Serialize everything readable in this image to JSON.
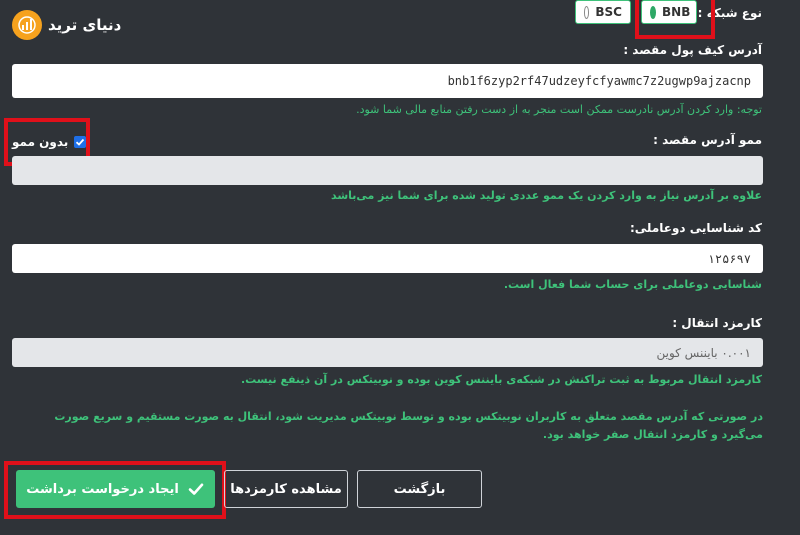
{
  "logo": {
    "text": "دنیای ترید"
  },
  "network": {
    "label": "نوع شبکه :",
    "options": [
      {
        "label": "BNB",
        "selected": true
      },
      {
        "label": "BSC",
        "selected": false
      }
    ]
  },
  "wallet_address": {
    "label": "آدرس کیف پول مقصد :",
    "value": "bnb1f6zyp2rf47udzeyfcfyawmc7z2ugwp9ajzacnp",
    "warning": "توجه: وارد کردن آدرس نادرست ممکن است منجر به از دست رفتن منابع مالی شما شود."
  },
  "memo": {
    "label": "ممو آدرس مقصد :",
    "no_memo_label": "بدون ممو",
    "no_memo_checked": true,
    "value": "",
    "hint": "علاوه بر آدرس نیاز به وارد کردن یک ممو عددی تولید شده برای شما نیز می‌باشد"
  },
  "two_factor": {
    "label": "کد شناسایی دوعاملی:",
    "value": "۱۲۵۶۹۷",
    "hint": "شناسایی دوعاملی برای حساب شما فعال است."
  },
  "fee": {
    "label": "کارمزد انتقال :",
    "value": "۰.۰۰۱ بایننس کوین",
    "hint": "کارمزد انتقال مربوط به ثبت تراکنش در شبکه‌ی بایننس کوین بوده و نوبیتکس در آن ذینفع نیست."
  },
  "internal_note": "در صورتی که آدرس مقصد متعلق به کاربران نوبیتکس بوده و توسط نوبیتکس مدیریت شود، انتقال به صورت مستقیم و سریع صورت می‌گیرد و کارمزد انتقال صفر خواهد بود.",
  "buttons": {
    "create": "ایجاد درخواست برداشت",
    "view_fees": "مشاهده کارمزدها",
    "back": "بازگشت"
  },
  "colors": {
    "background": "#2f3338",
    "accent_green": "#3ec27a",
    "highlight_red": "#e0101a",
    "logo_orange": "#f6a21e"
  }
}
